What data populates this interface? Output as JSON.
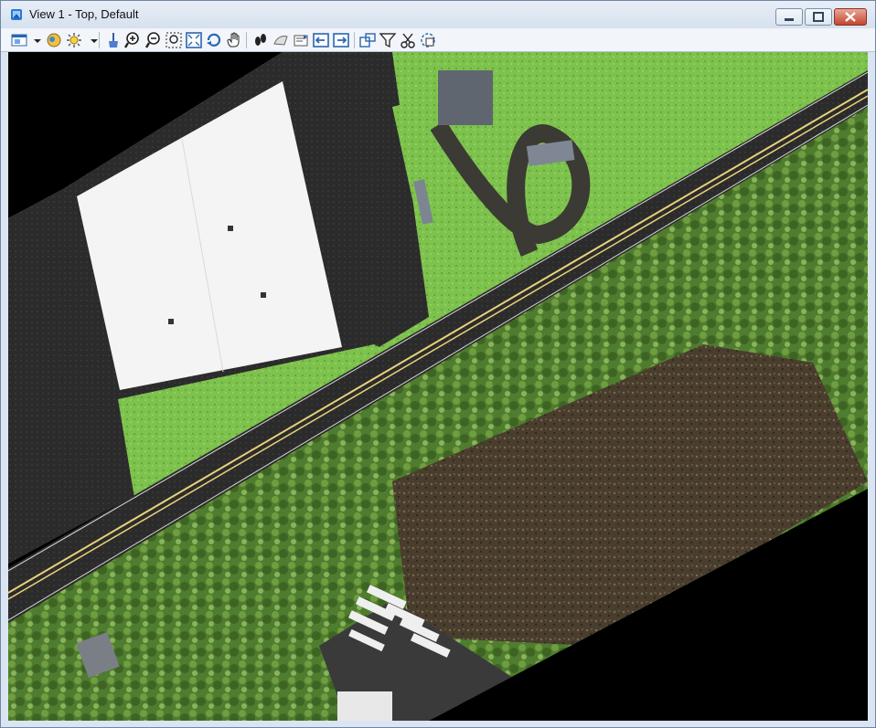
{
  "window": {
    "title": "View 1 - Top, Default",
    "colors": {
      "title_bg": "#dbe5f2",
      "close_btn": "#c4452f",
      "viewport_bg": "#000000",
      "road": "#262626",
      "grass": "#7fc44e",
      "roof": "#f6f6f6",
      "trees": "#4c7a2c",
      "bare_ground": "#5a4a36"
    }
  },
  "toolbar": {
    "buttons": [
      {
        "name": "view-attributes-icon"
      },
      {
        "name": "dropdown-arrow-icon"
      },
      {
        "name": "view-display-mode-icon"
      },
      {
        "name": "lighting-icon"
      },
      {
        "name": "dropdown-arrow-icon"
      },
      {
        "name": "update-view-icon"
      },
      {
        "name": "zoom-in-icon"
      },
      {
        "name": "zoom-out-icon"
      },
      {
        "name": "window-area-icon"
      },
      {
        "name": "fit-view-icon"
      },
      {
        "name": "rotate-view-icon"
      },
      {
        "name": "pan-view-icon"
      },
      {
        "name": "walk-icon"
      },
      {
        "name": "view-previous-icon"
      },
      {
        "name": "view-next-icon"
      },
      {
        "name": "copy-view-icon"
      },
      {
        "name": "previous-arrow-icon"
      },
      {
        "name": "next-arrow-icon"
      },
      {
        "name": "clip-volume-icon"
      },
      {
        "name": "clip-mask-icon"
      },
      {
        "name": "cut-clip-icon"
      },
      {
        "name": "fence-clip-icon"
      }
    ]
  }
}
